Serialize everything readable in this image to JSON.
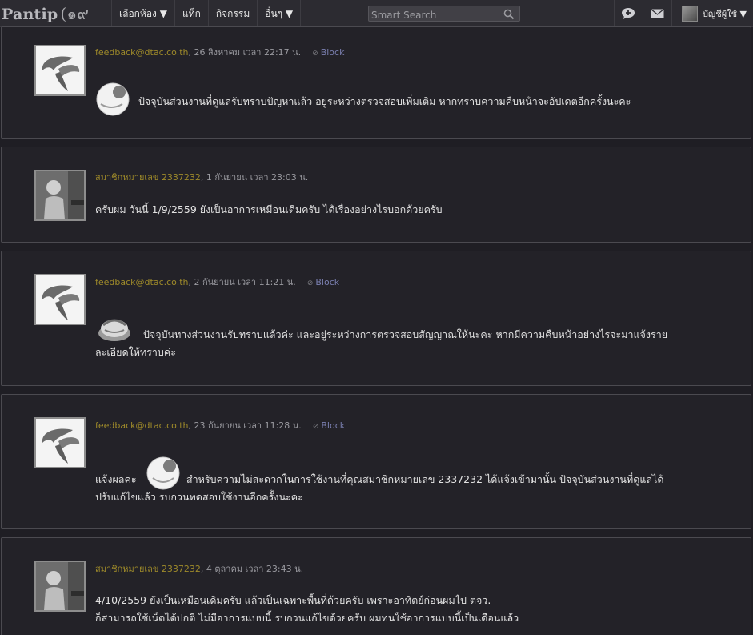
{
  "header": {
    "logo_text": "Pantip",
    "logo_thai": "(๑๙",
    "nav": [
      "เลือกห้อง ▼",
      "แท็ก",
      "กิจกรรม",
      "อื่นๆ ▼"
    ],
    "search_placeholder": "Smart Search",
    "icons": [
      "search-icon",
      "chat-bubble-icon",
      "mail-icon"
    ],
    "user_menu_label": "บัญชีผู้ใช้ ▼"
  },
  "comments": [
    {
      "author": "feedback@dtac.co.th",
      "date": ", 26 สิงหาคม เวลา 22:17 น.",
      "block_label": "Block",
      "avatar": "dtac-logo",
      "lines": [
        "ปัจจุบันส่วนงานที่ดูแลรับทราบปัญหาแล้ว อยู่ระหว่างตรวจสอบเพิ่มเติม หากทราบความคืบหน้าจะอัปเดตอีกครั้งนะคะ"
      ]
    },
    {
      "author": "สมาชิกหมายเลข 2337232",
      "date": ", 1 กันยายน เวลา 23:03 น.",
      "avatar": "user-photo",
      "lines": [
        "ครับผม วันนี้ 1/9/2559 ยังเป็นอาการเหมือนเดิมครับ ได้เรื่องอย่างไรบอกด้วยครับ"
      ]
    },
    {
      "author": "feedback@dtac.co.th",
      "date": ", 2 กันยายน เวลา 11:21 น.",
      "block_label": "Block",
      "avatar": "dtac-logo",
      "lines": [
        "ปัจจุบันทางส่วนงานรับทราบแล้วค่ะ และอยู่ระหว่างการตรวจสอบสัญญาณให้นะคะ  หากมีความคืบหน้าอย่างไรจะมาแจ้งราย",
        "ละเอียดให้ทราบค่ะ"
      ]
    },
    {
      "author": "feedback@dtac.co.th",
      "date": ", 23 กันยายน เวลา 11:28 น.",
      "block_label": "Block",
      "avatar": "dtac-logo",
      "prefix": "แจ้งผลค่ะ",
      "lines": [
        "สำหรับความไม่สะดวกในการใช้งานที่คุณสมาชิกหมายเลข 2337232 ได้แจ้งเข้ามานั้น  ปัจจุบันส่วนงานที่ดูแลได้",
        "ปรับแก้ไขแล้ว  รบกวนทดสอบใช้งานอีกครั้งนะคะ"
      ]
    },
    {
      "author": "สมาชิกหมายเลข 2337232",
      "date": ", 4 ตุลาคม เวลา 23:43 น.",
      "avatar": "user-photo",
      "lines": [
        "4/10/2559 ยังเป็นเหมือนเดิมครับ แล้วเป็นเฉพาะพื้นที่ด้วยครับ เพราะอาทิตย์ก่อนผมไป ตจว.",
        "ก็สามารถใช้เน็ตได้ปกติ ไม่มีอาการแบบนี้ รบกวนแก้ไขด้วยครับ ผมทนใช้อาการแบบนี้เป็นเดือนแล้ว"
      ]
    }
  ],
  "colors": {
    "background": "#1f1e24",
    "card": "#232228",
    "author": "#9e8a2a",
    "block": "#7a7fb0"
  }
}
